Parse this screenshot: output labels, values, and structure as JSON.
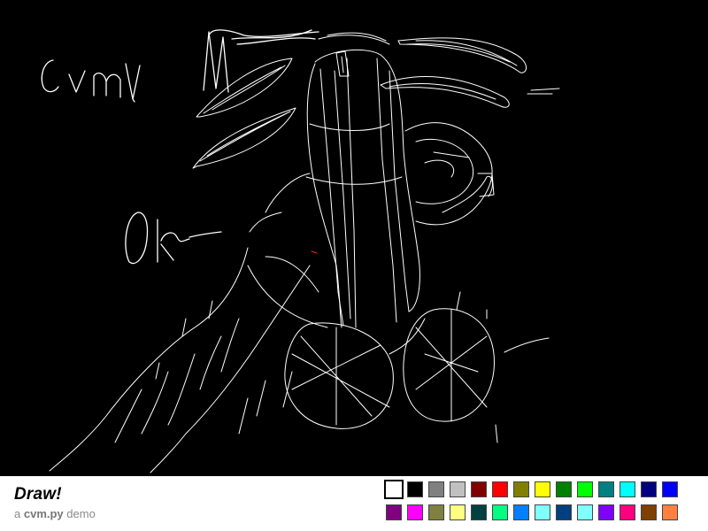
{
  "app": {
    "title": "Draw!",
    "subtitle_prefix": "a",
    "subtitle_name": "cvm.py",
    "subtitle_suffix": "demo"
  },
  "canvas": {
    "background": "#000000",
    "stroke_color": "#ffffff",
    "accent_stroke_color": "#cc2200"
  },
  "palette": {
    "selected_index": 0,
    "row1": [
      "#ffffff",
      "#000000",
      "#808080",
      "#c0c0c0",
      "#800000",
      "#ff0000",
      "#808000",
      "#ffff00",
      "#008000",
      "#00ff00",
      "#008080",
      "#00ffff",
      "#000080",
      "#0000ff"
    ],
    "row2": [
      "#800080",
      "#ff00ff",
      "#808040",
      "#ffff80",
      "#004040",
      "#00ff80",
      "#0080ff",
      "#80ffff",
      "#004080",
      "#80ffff",
      "#8000ff",
      "#ff0080",
      "#804000",
      "#ff8040"
    ]
  }
}
